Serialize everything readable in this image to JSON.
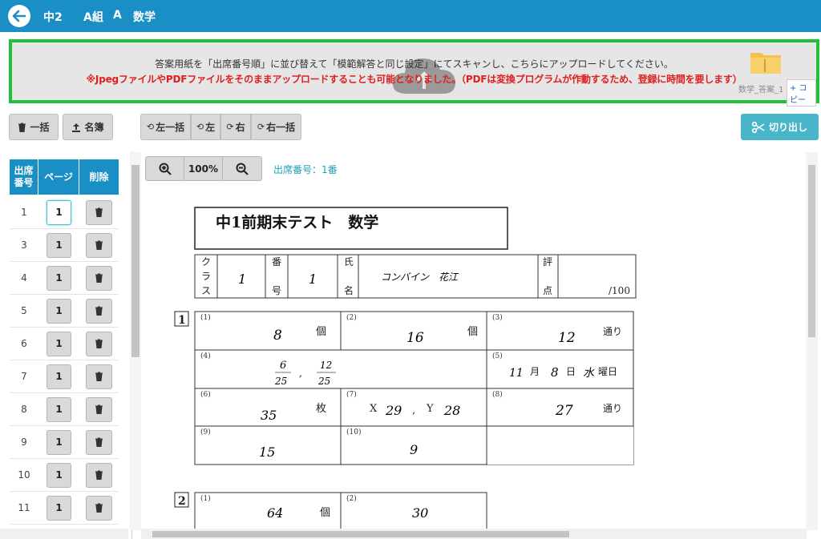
{
  "header": {
    "grade": "中2",
    "class": "A組",
    "course": "A",
    "subject": "数学"
  },
  "upload": {
    "line1": "答案用紙を「出席番号順」に並び替えて「模範解答と同じ設定」にてスキャンし、こちらにアップロードしてください。",
    "line2": "※JpegファイルやPDFファイルをそのままアップロードすることも可能となりました。（PDFは変換プログラムが作動するため、登録に時間を要します）",
    "file_name": "数学_答案_1",
    "copy_label": "+ コピー"
  },
  "toolbar": {
    "bulk_delete": "一括",
    "roster": "名簿",
    "left_all": "左一括",
    "left": "左",
    "right": "右",
    "right_all": "右一括",
    "cut": "切り出し"
  },
  "table": {
    "col_seat": "出席\n番号",
    "col_page": "ページ",
    "col_delete": "削除",
    "rows": [
      {
        "seat": "1",
        "page": "1"
      },
      {
        "seat": "3",
        "page": "1"
      },
      {
        "seat": "4",
        "page": "1"
      },
      {
        "seat": "5",
        "page": "1"
      },
      {
        "seat": "6",
        "page": "1"
      },
      {
        "seat": "7",
        "page": "1"
      },
      {
        "seat": "8",
        "page": "1"
      },
      {
        "seat": "9",
        "page": "1"
      },
      {
        "seat": "10",
        "page": "1"
      },
      {
        "seat": "11",
        "page": "1"
      }
    ]
  },
  "viewer": {
    "zoom": "100%",
    "seat_label": "出席番号：1番"
  },
  "sheet": {
    "title": "中1前期末テスト　数学",
    "h_class": "クラス",
    "h_number": "番号",
    "h_name": "氏名",
    "h_score": "評点",
    "class_val": "1",
    "number_val": "1",
    "name_val": "コンバイン　花江",
    "score_max": "/100",
    "sec1": "1",
    "sec2": "2",
    "q": {
      "q1": {
        "no": "(1)",
        "ans": "8",
        "unit": "個"
      },
      "q2": {
        "no": "(2)",
        "ans": "16",
        "unit": "個"
      },
      "q3": {
        "no": "(3)",
        "ans": "12",
        "unit": "通り"
      },
      "q4": {
        "no": "(4)",
        "ans_a_num": "6",
        "ans_a_den": "25",
        "ans_b_num": "12",
        "ans_b_den": "25",
        "sep": ","
      },
      "q5": {
        "no": "(5)",
        "month": "11",
        "month_u": "月",
        "day": "8",
        "day_u": "日",
        "wd": "水",
        "wd_u": "曜日"
      },
      "q6": {
        "no": "(6)",
        "ans": "35",
        "unit": "枚"
      },
      "q7": {
        "no": "(7)",
        "xl": "X",
        "xv": "29",
        "sep": ",",
        "yl": "Y",
        "yv": "28"
      },
      "q8": {
        "no": "(8)",
        "ans": "27",
        "unit": "通り"
      },
      "q9": {
        "no": "(9)",
        "ans": "15"
      },
      "q10": {
        "no": "(10)",
        "ans": "9"
      },
      "s2q1": {
        "no": "(1)",
        "ans": "64",
        "unit": "個"
      },
      "s2q2": {
        "no": "(2)",
        "ans": "30"
      }
    }
  },
  "colors": {
    "header_bg": "#1a8fc6",
    "drop_border": "#22c03a",
    "cut_bg": "#48b6c8",
    "notice_red": "#e02020"
  }
}
